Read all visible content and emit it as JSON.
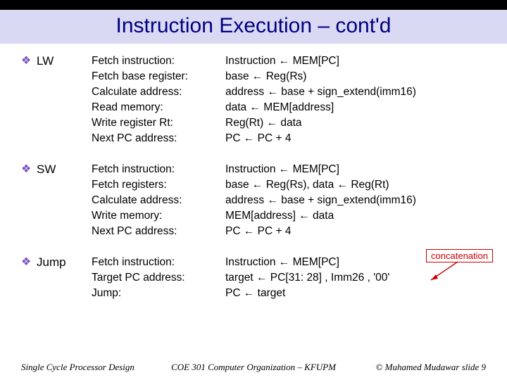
{
  "title": "Instruction Execution – cont'd",
  "sections": [
    {
      "label": "LW",
      "steps": [
        "Fetch instruction:",
        "Fetch base register:",
        "Calculate address:",
        "Read memory:",
        "Write register Rt:",
        "Next PC address:"
      ],
      "rtl": [
        "Instruction ← MEM[PC]",
        "base ← Reg(Rs)",
        "address ← base + sign_extend(imm16)",
        "data ← MEM[address]",
        "Reg(Rt) ← data",
        "PC ← PC + 4"
      ]
    },
    {
      "label": "SW",
      "steps": [
        "Fetch instruction:",
        "Fetch registers:",
        "Calculate address:",
        "Write memory:",
        "Next PC address:"
      ],
      "rtl": [
        "Instruction ← MEM[PC]",
        "base ← Reg(Rs), data ← Reg(Rt)",
        "address ← base + sign_extend(imm16)",
        "MEM[address] ← data",
        "PC ← PC + 4"
      ]
    },
    {
      "label": "Jump",
      "steps": [
        "Fetch instruction:",
        "Target PC address:",
        "Jump:"
      ],
      "rtl": [
        "Instruction ← MEM[PC]",
        "target ← PC[31: 28] , Imm26 , '00'",
        "PC ← target"
      ]
    }
  ],
  "callout_concat": "concatenation",
  "bullet": "❖",
  "footer": {
    "left": "Single Cycle Processor Design",
    "center": "COE 301 Computer Organization – KFUPM",
    "right": "© Muhamed Mudawar  slide 9"
  }
}
